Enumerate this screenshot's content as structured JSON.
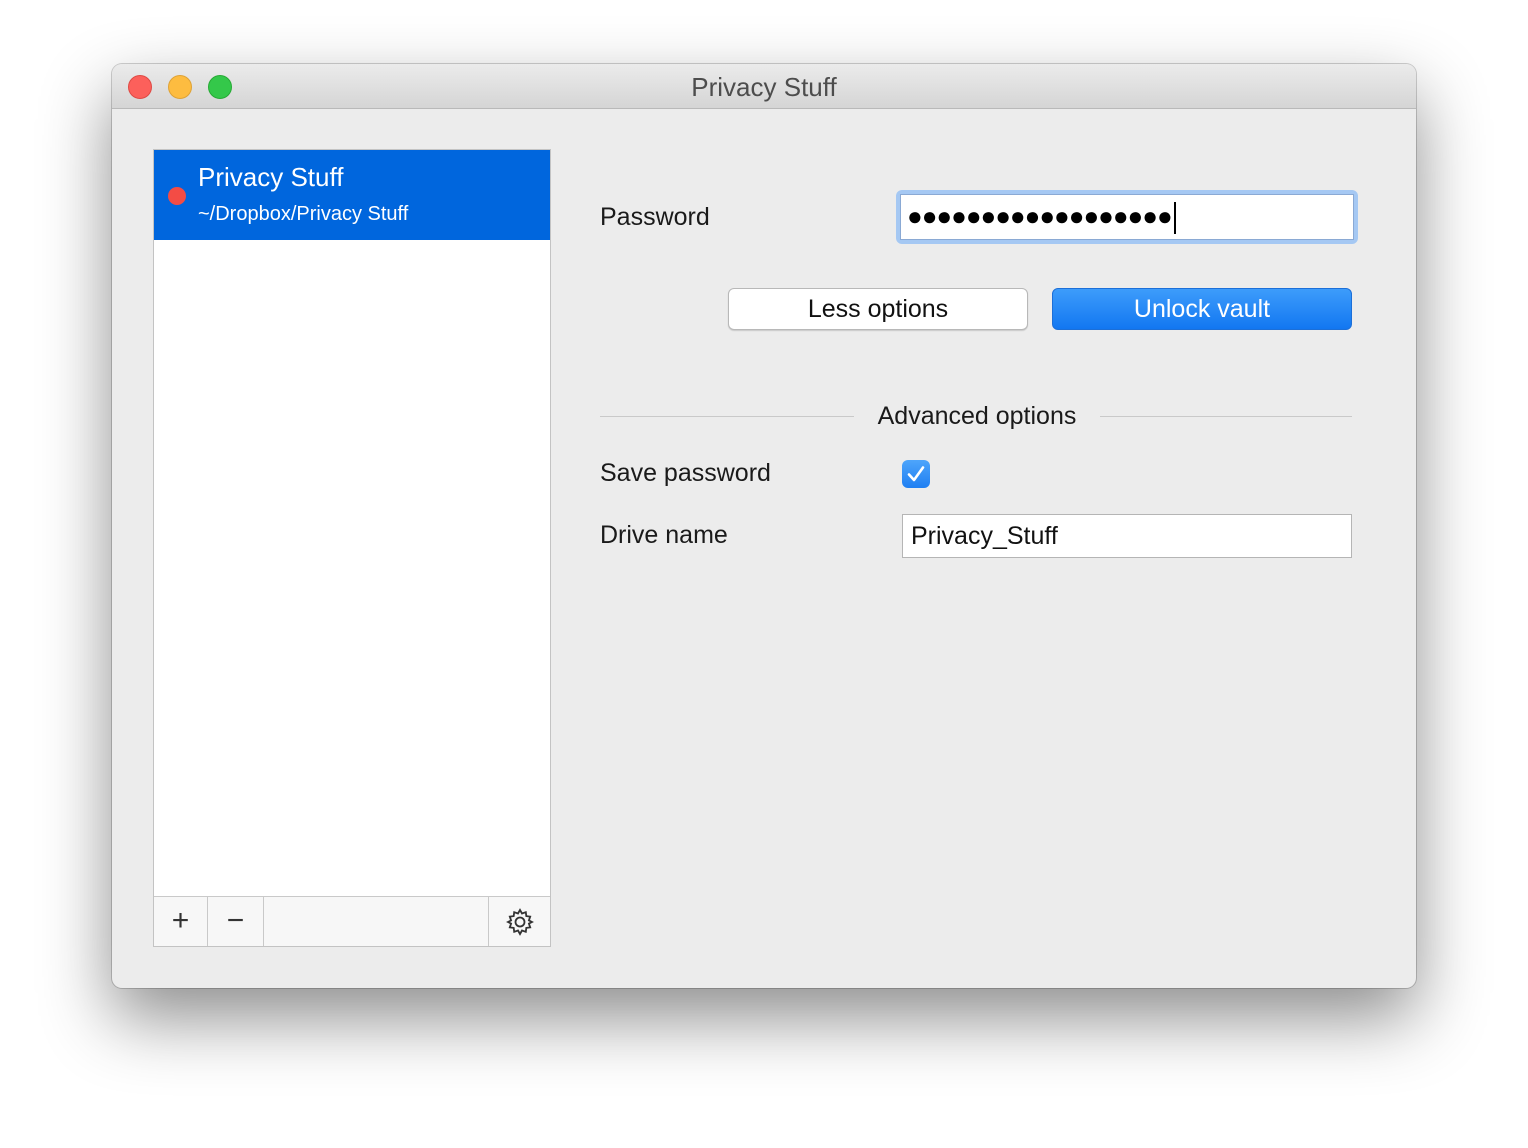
{
  "window": {
    "title": "Privacy Stuff"
  },
  "vaults": {
    "items": [
      {
        "name": "Privacy Stuff",
        "path": "~/Dropbox/Privacy Stuff",
        "status_color": "#f34c45",
        "selected": true
      }
    ],
    "toolbar": {
      "add_label": "+",
      "remove_label": "−",
      "settings_icon": "gear-icon"
    }
  },
  "unlock_form": {
    "password_label": "Password",
    "password_masked": "●●●●●●●●●●●●●●●●●●",
    "less_options_label": "Less options",
    "unlock_label": "Unlock vault",
    "advanced_title": "Advanced options",
    "save_password_label": "Save password",
    "save_password_checked": true,
    "drive_name_label": "Drive name",
    "drive_name_value": "Privacy_Stuff"
  },
  "colors": {
    "accent": "#0066dd",
    "button_primary": "#1a7ff4"
  }
}
